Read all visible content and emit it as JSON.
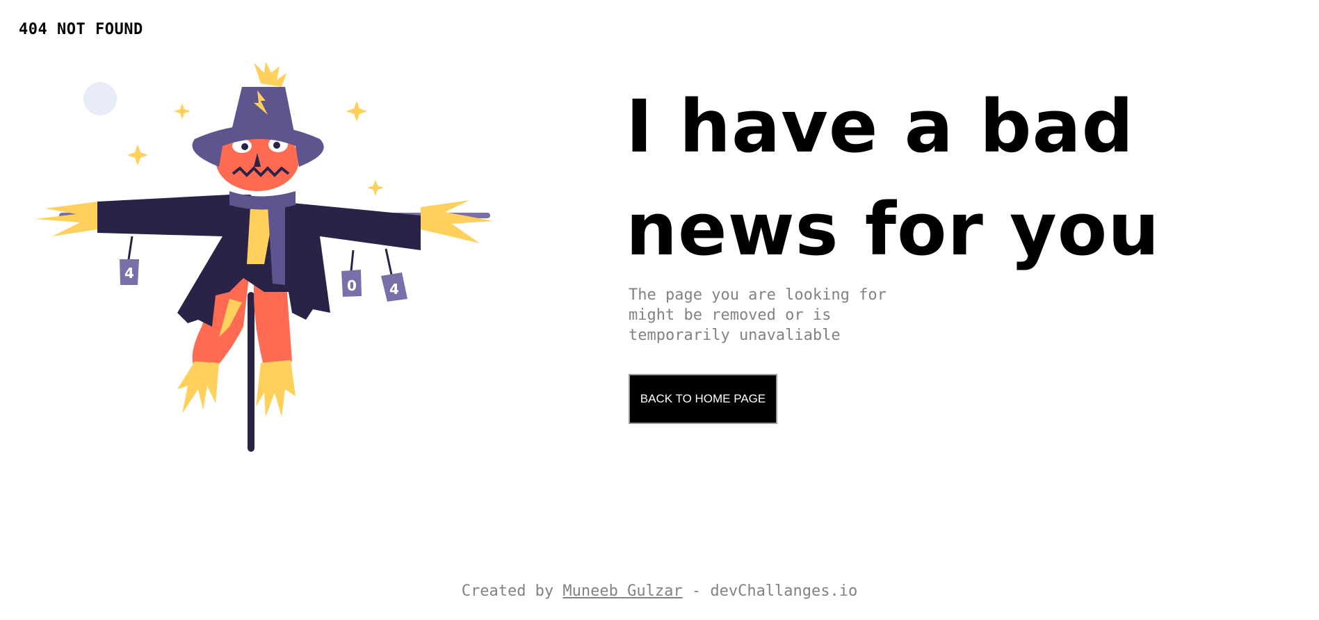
{
  "header": {
    "title": "404 NOT FOUND"
  },
  "illustration": {
    "can_labels": [
      "4",
      "0",
      "4"
    ]
  },
  "main": {
    "headline": "I have a bad news for you",
    "description": "The page you are looking for might be removed or is temporarily unavaliable",
    "button_label": "BACK TO HOME PAGE"
  },
  "footer": {
    "prefix": "Created by ",
    "author": "Muneeb Gulzar",
    "suffix": " - devChallanges.io"
  },
  "colors": {
    "hat": "#5E548E",
    "coat": "#2B2347",
    "face": "#FF6B52",
    "straw": "#FFD15C",
    "moon": "#E8ECF8",
    "button_bg": "#000000",
    "muted_text": "#828282"
  }
}
